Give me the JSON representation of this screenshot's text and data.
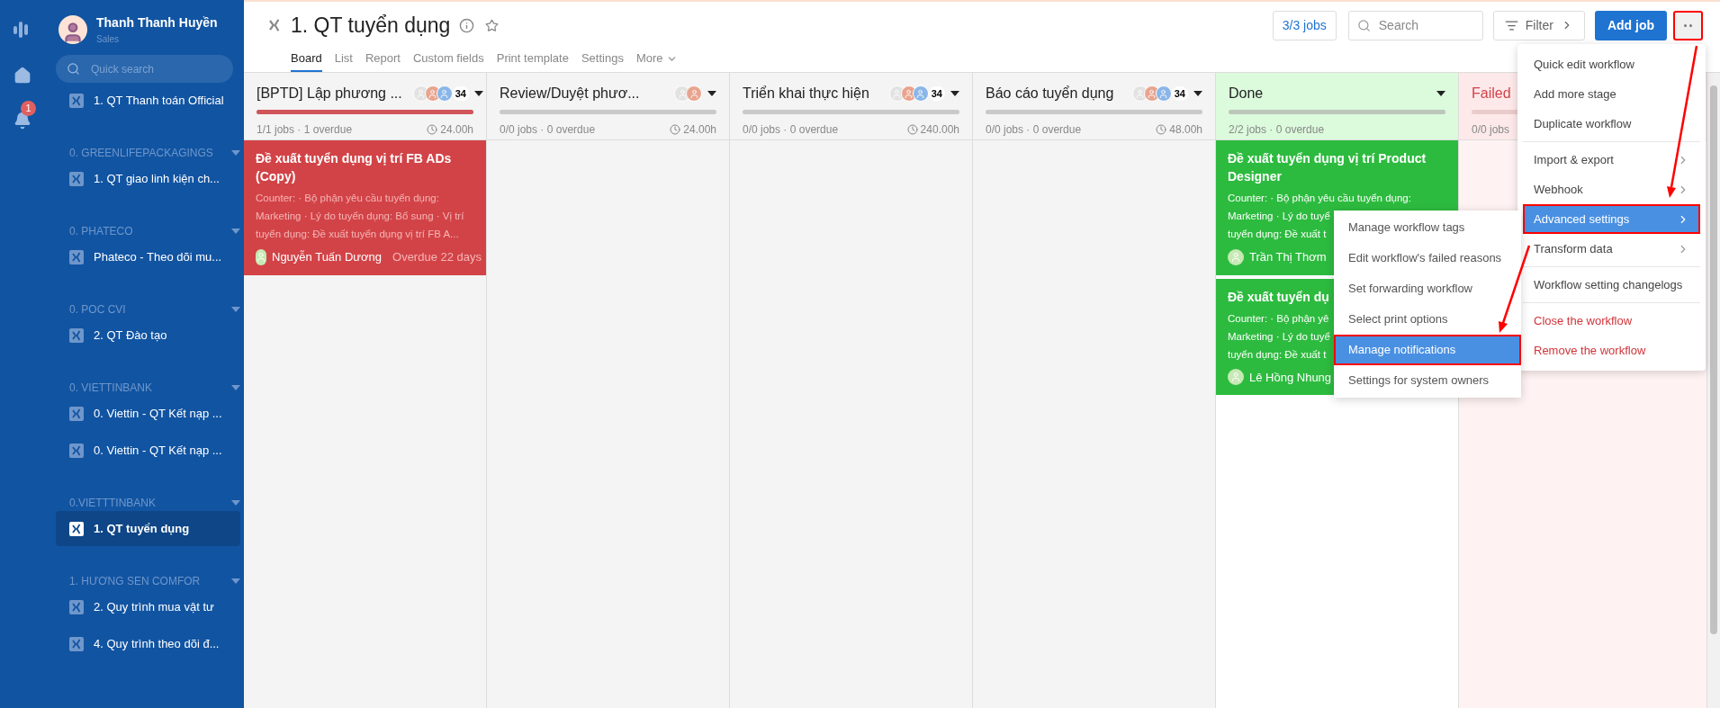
{
  "rail": {
    "notification_badge": "1"
  },
  "user": {
    "name": "Thanh Thanh Huyền",
    "role": "Sales"
  },
  "sidebar": {
    "search": {
      "placeholder": "Quick search"
    },
    "sections": [
      {
        "items": [
          {
            "label": "1. QT Thanh toán Official",
            "selected": false
          }
        ]
      },
      {
        "title": "0. GREENLIFEPACKAGINGS",
        "items": [
          {
            "label": "1. QT giao linh kiện ch...",
            "selected": false
          }
        ]
      },
      {
        "title": "0. PHATECO",
        "items": [
          {
            "label": "Phateco - Theo dõi mu...",
            "selected": false
          }
        ]
      },
      {
        "title": "0. POC CVI",
        "items": [
          {
            "label": "2. QT Đào tạo",
            "selected": false
          }
        ]
      },
      {
        "title": "0. VIETTINBANK",
        "items": [
          {
            "label": "0. Viettin - QT Kết nạp ...",
            "selected": false
          },
          {
            "label": "0. Viettin - QT Kết nạp ...",
            "selected": false
          }
        ]
      },
      {
        "title": "0.VIETTTINBANK",
        "items": [
          {
            "label": "1. QT tuyển dụng",
            "selected": true
          }
        ]
      },
      {
        "title": "1. HƯƠNG SEN COMFOR",
        "items": [
          {
            "label": "2. Quy trình mua vật tư",
            "selected": false
          },
          {
            "label": "4. Quy trình theo dõi đ...",
            "selected": false
          }
        ]
      }
    ]
  },
  "header": {
    "title": "1. QT tuyển dụng",
    "tabs": [
      {
        "label": "Board",
        "selected": true
      },
      {
        "label": "List",
        "selected": false
      },
      {
        "label": "Report",
        "selected": false
      },
      {
        "label": "Custom fields",
        "selected": false
      },
      {
        "label": "Print template",
        "selected": false
      },
      {
        "label": "Settings",
        "selected": false
      }
    ],
    "more": "More",
    "job_count": "3/3 jobs",
    "search": {
      "placeholder": "Search"
    },
    "filter": "Filter",
    "add_job": "Add job",
    "more_button": {
      "annotated": true
    }
  },
  "columns": [
    {
      "kind": "normal",
      "title": "[BPTD] Lập phương ...",
      "member_count": "34",
      "caret": true,
      "level": 1,
      "jobs": "1/1 jobs · 1 overdue",
      "time": "24.00h",
      "cards": [
        {
          "kind": "overdue",
          "title": "Đề xuất tuyển dụng vị trí FB ADs (Copy)",
          "lines": [
            "Counter: · Bộ phận yêu cầu tuyển dụng:",
            "Marketing · Lý do tuyển dụng: Bổ sung · Vị trí",
            "tuyển dụng: Đề xuất tuyển dụng vị trí FB A..."
          ],
          "assignee": "Nguyễn Tuấn Dương",
          "due": "Overdue 22 days"
        }
      ]
    },
    {
      "kind": "normal",
      "title": "Review/Duyệt phươ...",
      "caret": true,
      "level": 0,
      "jobs": "0/0 jobs · 0 overdue",
      "time": "24.00h"
    },
    {
      "kind": "normal",
      "title": "Triển khai thực hiện",
      "member_count": "34",
      "caret": true,
      "level": 0,
      "jobs": "0/0 jobs · 0 overdue",
      "time": "240.00h"
    },
    {
      "kind": "normal",
      "title": "Báo cáo tuyển dụng",
      "member_count": "34",
      "caret": true,
      "level": 0,
      "jobs": "0/0 jobs · 0 overdue",
      "time": "48.00h"
    },
    {
      "kind": "done",
      "title": "Done",
      "caret": true,
      "level": 0,
      "jobs": "2/2 jobs · 0 overdue",
      "cards": [
        {
          "kind": "done",
          "title": "Đề xuất tuyển dụng vị trí Product Designer",
          "lines": [
            "Counter: · Bộ phận yêu cầu tuyển dụng:",
            "Marketing · Lý do tuyể",
            "tuyển dụng: Đề xuất t"
          ],
          "assignee": "Trần Thị Thơm"
        },
        {
          "kind": "done",
          "title": "Đề xuất tuyển dụ",
          "lines": [
            "Counter: · Bộ phận yê",
            "Marketing · Lý do tuyể",
            "tuyển dụng: Đề xuất t"
          ],
          "assignee": "Lê Hồng Nhung"
        }
      ]
    },
    {
      "kind": "failed",
      "title": "Failed",
      "caret": false,
      "level": 0,
      "jobs": "0/0 jobs"
    }
  ],
  "menu": {
    "groups": [
      [
        {
          "label": "Quick edit workflow",
          "kind": "plain",
          "selected": false,
          "annotated": false
        },
        {
          "label": "Add more stage",
          "kind": "plain",
          "selected": false,
          "annotated": false
        },
        {
          "label": "Duplicate workflow",
          "kind": "plain",
          "selected": false,
          "annotated": false
        }
      ],
      [
        {
          "label": "Import & export",
          "kind": "submenu",
          "selected": false,
          "annotated": false
        },
        {
          "label": "Webhook",
          "kind": "submenu",
          "selected": false,
          "annotated": false
        },
        {
          "label": "Advanced settings",
          "kind": "submenu",
          "selected": true,
          "annotated": true
        },
        {
          "label": "Transform data",
          "kind": "submenu",
          "selected": false,
          "annotated": false
        }
      ],
      [
        {
          "label": "Workflow setting changelogs",
          "kind": "plain",
          "selected": false,
          "annotated": false
        }
      ],
      [
        {
          "label": "Close the workflow",
          "kind": "danger",
          "selected": false,
          "annotated": false
        },
        {
          "label": "Remove the workflow",
          "kind": "danger",
          "selected": false,
          "annotated": false
        }
      ]
    ]
  },
  "submenu": {
    "items": [
      {
        "label": "Manage workflow tags",
        "selected": false,
        "annotated": false
      },
      {
        "label": "Edit workflow's failed reasons",
        "selected": false,
        "annotated": false
      },
      {
        "label": "Set forwarding workflow",
        "selected": false,
        "annotated": false
      },
      {
        "label": "Select print options",
        "selected": false,
        "annotated": false
      },
      {
        "label": "Manage notifications",
        "selected": true,
        "annotated": true
      },
      {
        "label": "Settings for system owners",
        "selected": false,
        "annotated": false
      }
    ]
  }
}
